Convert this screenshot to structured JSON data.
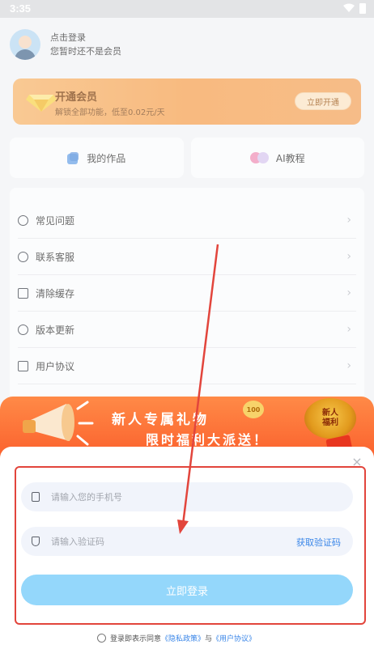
{
  "status_bar": {
    "time": "3:35"
  },
  "user": {
    "login_prompt": "点击登录",
    "member_status": "您暂时还不是会员"
  },
  "vip": {
    "title": "开通会员",
    "subtitle": "解锁全部功能，低至0.02元/天",
    "button": "立即开通"
  },
  "quick": [
    {
      "label": "我的作品",
      "icon": "works-icon"
    },
    {
      "label": "AI教程",
      "icon": "ai-icon"
    }
  ],
  "menu": [
    {
      "label": "常见问题",
      "icon": "faq-icon"
    },
    {
      "label": "联系客服",
      "icon": "headset-icon"
    },
    {
      "label": "清除缓存",
      "icon": "clear-cache-icon"
    },
    {
      "label": "版本更新",
      "icon": "update-icon"
    },
    {
      "label": "用户协议",
      "icon": "document-icon"
    }
  ],
  "promo": {
    "line1": "新人专属礼物",
    "line2": "限时福利大派送！",
    "badge_line1": "新人",
    "badge_line2": "福利",
    "coin": "100"
  },
  "login": {
    "phone_placeholder": "请输入您的手机号",
    "code_placeholder": "请输入验证码",
    "get_code": "获取验证码",
    "submit": "立即登录",
    "agree_prefix": "登录即表示同意",
    "privacy": "《隐私政策》",
    "and": "与",
    "terms": "《用户协议》"
  },
  "colors": {
    "highlight": "#e2453c",
    "login_button": "#94d7fb",
    "link": "#3a86e8",
    "promo": "#fb5f2c"
  }
}
